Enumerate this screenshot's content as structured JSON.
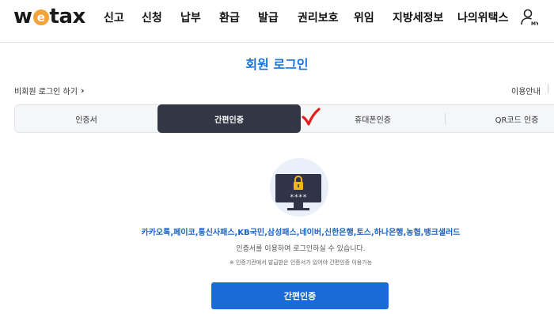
{
  "header": {
    "logo_text_w": "w",
    "logo_text_e": "e",
    "logo_text_tax": "tax",
    "nav": [
      "신고",
      "신청",
      "납부",
      "환급",
      "발급",
      "권리보호",
      "위임",
      "지방세정보",
      "나의위택스"
    ],
    "user_icon_label": "MY"
  },
  "page": {
    "title": "회원 로그인",
    "non_member_link": "비회원 로그인 하기",
    "guide_link": "이용안내"
  },
  "tabs": [
    {
      "label": "인증서",
      "active": false
    },
    {
      "label": "간편인증",
      "active": true
    },
    {
      "label": "휴대폰인증",
      "active": false
    },
    {
      "label": "QR코드 인증",
      "active": false
    }
  ],
  "body": {
    "pin_mask": "****",
    "providers": "카카오톡,페이코,통신사패스,KB국민,삼성패스,네이버,신한은행,토스,하나은행,농협,뱅크샐러드",
    "description": "인증서를 이용하여 로그인하실 수 있습니다.",
    "note": "※ 인증기관에서 발급받은 인증서가 있어야 간편인증 이용가능",
    "button_label": "간편인증"
  },
  "colors": {
    "brand_blue": "#1a6ad8",
    "title_blue": "#1a73d9",
    "active_tab": "#333645",
    "logo_orange": "#f2a33a",
    "check_red": "#e0201c"
  }
}
